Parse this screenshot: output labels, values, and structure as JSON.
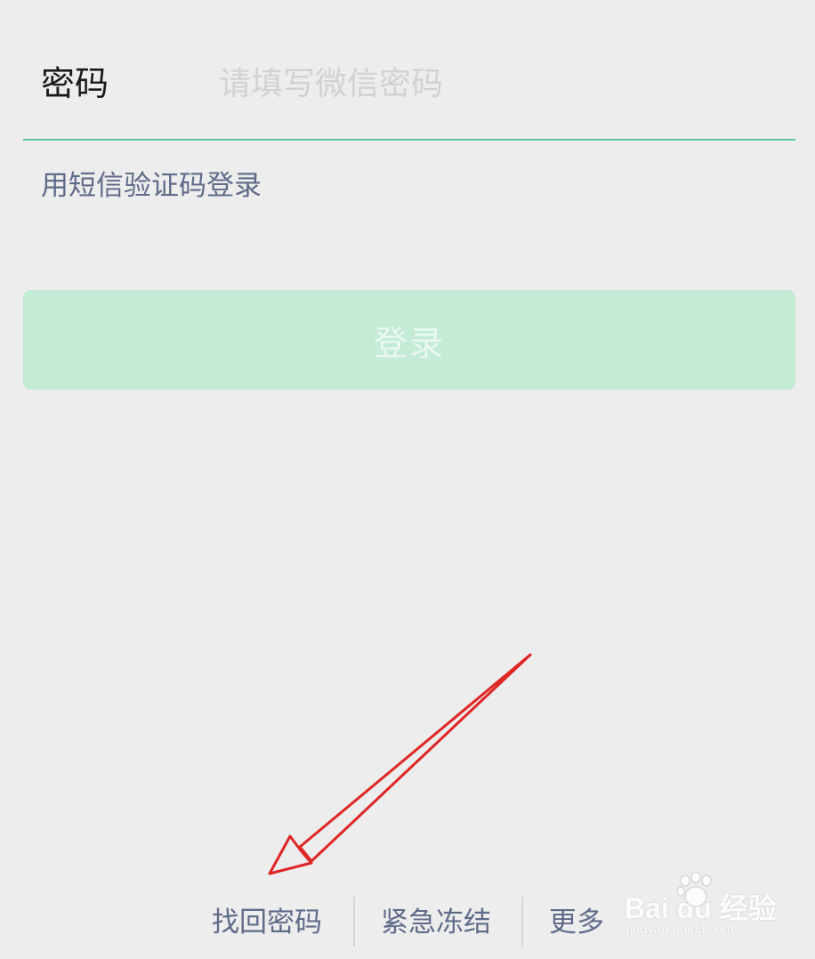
{
  "login_form": {
    "password_label": "密码",
    "password_placeholder": "请填写微信密码",
    "password_value": "",
    "sms_login_link": "用短信验证码登录",
    "login_button_label": "登录"
  },
  "footer": {
    "links": [
      {
        "label": "找回密码"
      },
      {
        "label": "紧急冻结"
      },
      {
        "label": "更多"
      }
    ]
  },
  "watermark": {
    "brand": "Bai du 经验",
    "url": "jingyan.baidu.com"
  },
  "annotation": {
    "arrow_color": "#e02525"
  },
  "colors": {
    "accent_green": "#5fc49a",
    "disabled_button": "#c3ebd5",
    "link_text": "#5f6b8a",
    "background": "#ededed"
  }
}
